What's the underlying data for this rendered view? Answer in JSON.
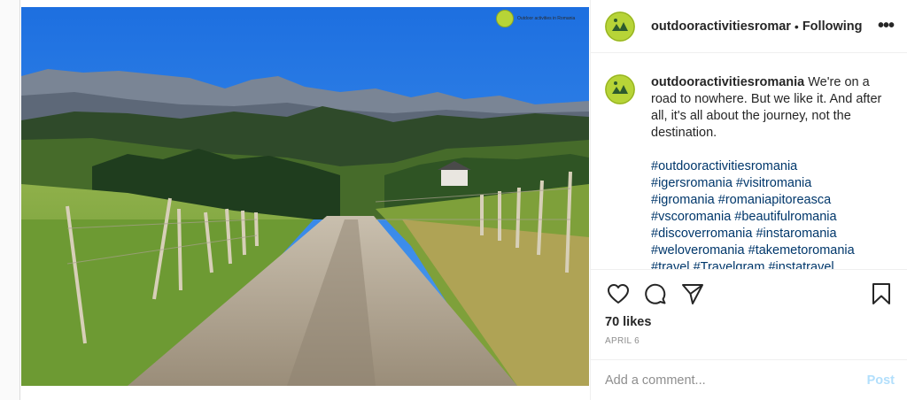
{
  "post": {
    "photo_alt": "",
    "watermark_text": "Outdoor activities in Romania"
  },
  "header": {
    "username": "outdooractivitiesromar",
    "separator": "•",
    "follow_status": "Following",
    "more_label": "•••"
  },
  "caption": {
    "username": "outdooractivitiesromania",
    "text": " We're on a road to nowhere. But we like it. And after all, it's all about the journey, not the destination.",
    "hashtags": [
      "#outdooractivitiesromania",
      "#igersromania",
      "#visitromania",
      "#igromania",
      "#romaniapitoreasca",
      "#vscoromania",
      "#beautifulromania",
      "#discoverromania",
      "#instaromania",
      "#weloveromania",
      "#takemetoromania",
      "#travel",
      "#Travelgram",
      "#instatravel"
    ]
  },
  "actions": {
    "like_icon": "heart-icon",
    "comment_icon": "comment-icon",
    "share_icon": "share-icon",
    "save_icon": "bookmark-icon"
  },
  "stats": {
    "likes": "70 likes",
    "date": "APRIL 6"
  },
  "comment_box": {
    "placeholder": "Add a comment...",
    "post_label": "Post",
    "post_color": "#b2dffc"
  },
  "colors": {
    "avatar_bg": "#b7d437",
    "hashtag": "#00376b",
    "border": "#efefef"
  }
}
